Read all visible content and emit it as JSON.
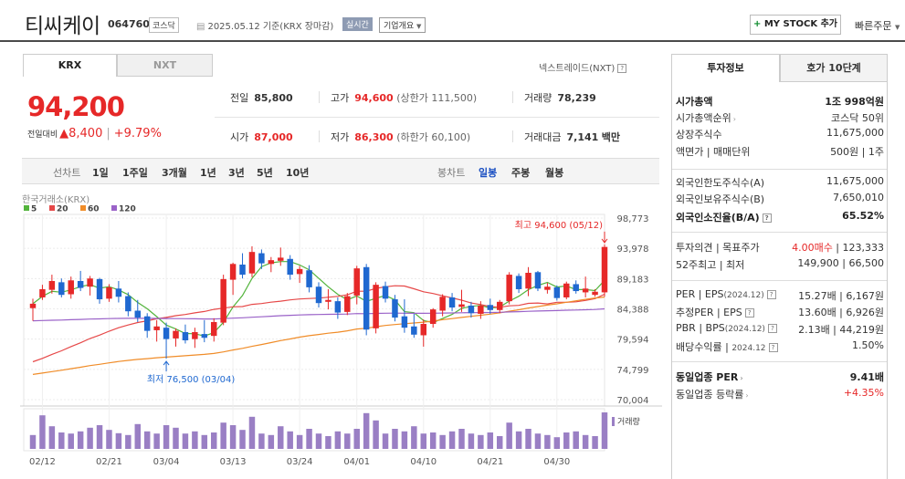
{
  "header": {
    "title": "티씨케이",
    "code": "064760",
    "market": "코스닥",
    "date": "2025.05.12 기준(KRX 장마감)",
    "realtime": "실시간",
    "overview": "기업개요",
    "mystock": "MY STOCK 추가",
    "quick": "빠른주문"
  },
  "tabs": {
    "krx": "KRX",
    "nxt": "NXT",
    "nxt_link": "넥스트레이드(NXT)"
  },
  "price": {
    "current": "94,200",
    "change_label": "전일대비",
    "change": "▲8,400",
    "change_pct": "+9.79%"
  },
  "quote": {
    "prev_label": "전일",
    "prev": "85,800",
    "high_label": "고가",
    "high": "94,600",
    "upper": "(상한가 111,500)",
    "vol_label": "거래량",
    "vol": "78,239",
    "open_label": "시가",
    "open": "87,000",
    "low_label": "저가",
    "low": "86,300",
    "lower": "(하한가 60,100)",
    "amt_label": "거래대금",
    "amt": "7,141",
    "amt_unit": "백만"
  },
  "chart_toolbar": {
    "line_label": "선차트",
    "periods": [
      "1일",
      "1주일",
      "3개월",
      "1년",
      "3년",
      "5년",
      "10년"
    ],
    "candle_label": "봉차트",
    "candles": [
      "일봉",
      "주봉",
      "월봉"
    ]
  },
  "chart_data": {
    "type": "candlestick",
    "source": "한국거래소(KRX)",
    "ma_legend": [
      {
        "name": "5",
        "color": "#53b43c"
      },
      {
        "name": "20",
        "color": "#e64848"
      },
      {
        "name": "60",
        "color": "#f08c28"
      },
      {
        "name": "120",
        "color": "#9a62c8"
      }
    ],
    "y_ticks": [
      "98,773",
      "93,978",
      "89,183",
      "84,388",
      "79,594",
      "74,799",
      "70,004"
    ],
    "ylim": [
      70004,
      98773
    ],
    "x_ticks": [
      "02/12",
      "02/21",
      "03/04",
      "03/13",
      "03/24",
      "04/01",
      "04/10",
      "04/21",
      "04/30"
    ],
    "x_tick_index": [
      1,
      8,
      14,
      21,
      28,
      34,
      41,
      48,
      55
    ],
    "volume_label": "거래량",
    "max_annotation": "최고 94,600 (05/12)",
    "min_annotation": "최저 76,500 (03/04)",
    "ohlc": [
      [
        84500,
        86000,
        82500,
        85200
      ],
      [
        86200,
        88200,
        85800,
        87500
      ],
      [
        87400,
        89800,
        86800,
        88800
      ],
      [
        88600,
        89200,
        86200,
        86600
      ],
      [
        86700,
        89500,
        86000,
        88900
      ],
      [
        88800,
        90400,
        87200,
        87700
      ],
      [
        87900,
        89600,
        86500,
        89200
      ],
      [
        89100,
        89300,
        85200,
        85900
      ],
      [
        86000,
        88300,
        85500,
        87800
      ],
      [
        87600,
        88800,
        85400,
        86300
      ],
      [
        86400,
        87000,
        83200,
        84000
      ],
      [
        84100,
        85800,
        82300,
        83000
      ],
      [
        83200,
        83700,
        79800,
        80900
      ],
      [
        81000,
        82600,
        79200,
        81600
      ],
      [
        81400,
        82200,
        76500,
        79600
      ],
      [
        79700,
        81300,
        78400,
        80900
      ],
      [
        80700,
        81900,
        78900,
        79400
      ],
      [
        79600,
        81400,
        78200,
        80700
      ],
      [
        80400,
        82600,
        79100,
        79800
      ],
      [
        80100,
        82900,
        79200,
        82300
      ],
      [
        82200,
        89800,
        81800,
        89100
      ],
      [
        89000,
        91700,
        86600,
        91500
      ],
      [
        91400,
        93200,
        89200,
        89800
      ],
      [
        90000,
        94300,
        89400,
        93400
      ],
      [
        93200,
        93800,
        90700,
        91600
      ],
      [
        91500,
        92600,
        90200,
        92100
      ],
      [
        92000,
        94100,
        91200,
        92500
      ],
      [
        92300,
        92900,
        89000,
        89800
      ],
      [
        89900,
        91200,
        88500,
        90700
      ],
      [
        90500,
        91300,
        87000,
        87800
      ],
      [
        87900,
        88600,
        84600,
        85300
      ],
      [
        85500,
        87500,
        84300,
        85800
      ],
      [
        85600,
        86200,
        82800,
        83800
      ],
      [
        83900,
        86900,
        83400,
        86400
      ],
      [
        86500,
        91200,
        85100,
        90800
      ],
      [
        91000,
        91500,
        80200,
        81100
      ],
      [
        81300,
        88600,
        80500,
        88200
      ],
      [
        88000,
        88700,
        85400,
        86000
      ],
      [
        85900,
        86600,
        82400,
        83000
      ],
      [
        83200,
        85900,
        80600,
        81400
      ],
      [
        81600,
        83600,
        79800,
        80300
      ],
      [
        80200,
        82700,
        78400,
        82000
      ],
      [
        82000,
        84500,
        81400,
        84300
      ],
      [
        84100,
        86700,
        83200,
        86300
      ],
      [
        86200,
        86900,
        84000,
        84600
      ],
      [
        84700,
        87400,
        83900,
        85100
      ],
      [
        84900,
        85500,
        83000,
        83700
      ],
      [
        83600,
        85600,
        82800,
        84900
      ],
      [
        85000,
        86000,
        83600,
        84200
      ],
      [
        84200,
        85800,
        83700,
        85500
      ],
      [
        85600,
        90200,
        85100,
        89800
      ],
      [
        89600,
        90000,
        86900,
        87500
      ],
      [
        87600,
        91000,
        86400,
        90100
      ],
      [
        90200,
        90400,
        87200,
        87600
      ],
      [
        87400,
        88500,
        86800,
        87900
      ],
      [
        87800,
        88100,
        85700,
        86100
      ],
      [
        86200,
        88700,
        85900,
        88400
      ],
      [
        88300,
        88900,
        86800,
        87200
      ],
      [
        87000,
        89500,
        86200,
        87600
      ],
      [
        86600,
        87500,
        86300,
        87100
      ],
      [
        87000,
        94600,
        86300,
        94200
      ]
    ],
    "volume": [
      0.38,
      0.92,
      0.62,
      0.45,
      0.42,
      0.48,
      0.58,
      0.65,
      0.52,
      0.43,
      0.38,
      0.68,
      0.48,
      0.42,
      0.65,
      0.58,
      0.42,
      0.48,
      0.38,
      0.45,
      0.72,
      0.65,
      0.52,
      0.88,
      0.42,
      0.38,
      0.62,
      0.48,
      0.38,
      0.55,
      0.42,
      0.35,
      0.48,
      0.42,
      0.55,
      0.98,
      0.78,
      0.42,
      0.55,
      0.48,
      0.62,
      0.42,
      0.45,
      0.38,
      0.48,
      0.55,
      0.42,
      0.38,
      0.45,
      0.35,
      0.72,
      0.48,
      0.55,
      0.42,
      0.38,
      0.32,
      0.45,
      0.48,
      0.38,
      0.35,
      1.0
    ]
  },
  "right": {
    "tab1": "투자정보",
    "tab2": "호가 10단계",
    "rows": [
      {
        "k": "시가총액",
        "v": "1조 998억원",
        "bold": true
      },
      {
        "k": "시가총액순위",
        "v": "코스닥 50위",
        "arrow": true
      },
      {
        "k": "상장주식수",
        "v": "11,675,000"
      },
      {
        "k": "액면가 | 매매단위",
        "v": "500원 | 1주"
      },
      {
        "k": "외국인한도주식수(A)",
        "v": "11,675,000"
      },
      {
        "k": "외국인보유주식수(B)",
        "v": "7,650,010"
      },
      {
        "k": "외국인소진율(B/A)",
        "v": "65.52%",
        "bold": true,
        "q": true
      },
      {
        "k": "투자의견 | 목표주가",
        "v_red": "4.00매수",
        "v": " | 123,333"
      },
      {
        "k": "52주최고 | 최저",
        "v": "149,900 | 66,500"
      },
      {
        "k": "PER | EPS",
        "k_small": "(2024.12)",
        "v": "15.27배 | 6,167원",
        "q": true
      },
      {
        "k": "추정PER | EPS",
        "v": "13.60배 | 6,926원",
        "q": true
      },
      {
        "k": "PBR | BPS",
        "k_small": "(2024.12)",
        "v": "2.13배 | 44,219원",
        "q": true
      },
      {
        "k": "배당수익률 | ",
        "k_small": "2024.12",
        "v": "1.50%",
        "q": true
      },
      {
        "k": "동일업종 PER",
        "v": "9.41배",
        "bold": true,
        "arrow": true
      },
      {
        "k": "동일업종 등락률",
        "v_red": "+4.35%",
        "v": "",
        "arrow": true
      }
    ]
  }
}
